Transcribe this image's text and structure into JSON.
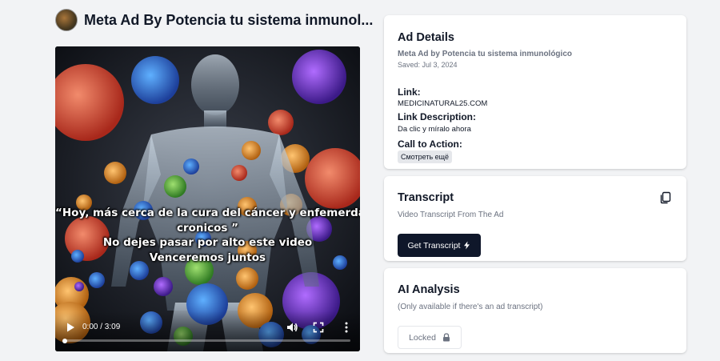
{
  "header": {
    "title": "Meta Ad By Potencia tu sistema inmunol..."
  },
  "video": {
    "caption_lines": [
      "“Hoy, más cerca de la cura del cáncer y enfemerdades",
      "cronicos ”",
      "No dejes pasar por alto este video",
      "Venceremos juntos"
    ],
    "time": "0:00 / 3:09",
    "progress": 0,
    "icons": {
      "play": "play-icon",
      "volume": "volume-icon",
      "fullscreen": "fullscreen-icon",
      "more": "more-vertical-icon"
    }
  },
  "ad_details": {
    "title": "Ad Details",
    "ad_name": "Meta Ad by Potencia tu sistema inmunológico",
    "saved": "Saved: Jul 3, 2024",
    "link_label": "Link:",
    "link_value": "MEDICINATURAL25.COM",
    "link_description_label": "Link Description:",
    "link_description_value": "Da clic y míralo ahora",
    "cta_label": "Call to Action:",
    "cta_value": "Смотреть ещё"
  },
  "transcript": {
    "title": "Transcript",
    "subtitle": "Video Transcript From The Ad",
    "button_label": "Get Transcript",
    "icons": {
      "copy": "copy-icon",
      "button": "lightning-icon"
    }
  },
  "ai_analysis": {
    "title": "AI Analysis",
    "subtitle": "(Only available if there's an ad transcript)",
    "button_label": "Locked",
    "icons": {
      "button": "lock-icon"
    }
  },
  "colors": {
    "page_bg": "#f2f3f5",
    "primary_button": "#0f172a",
    "muted_text": "#6b7280"
  }
}
